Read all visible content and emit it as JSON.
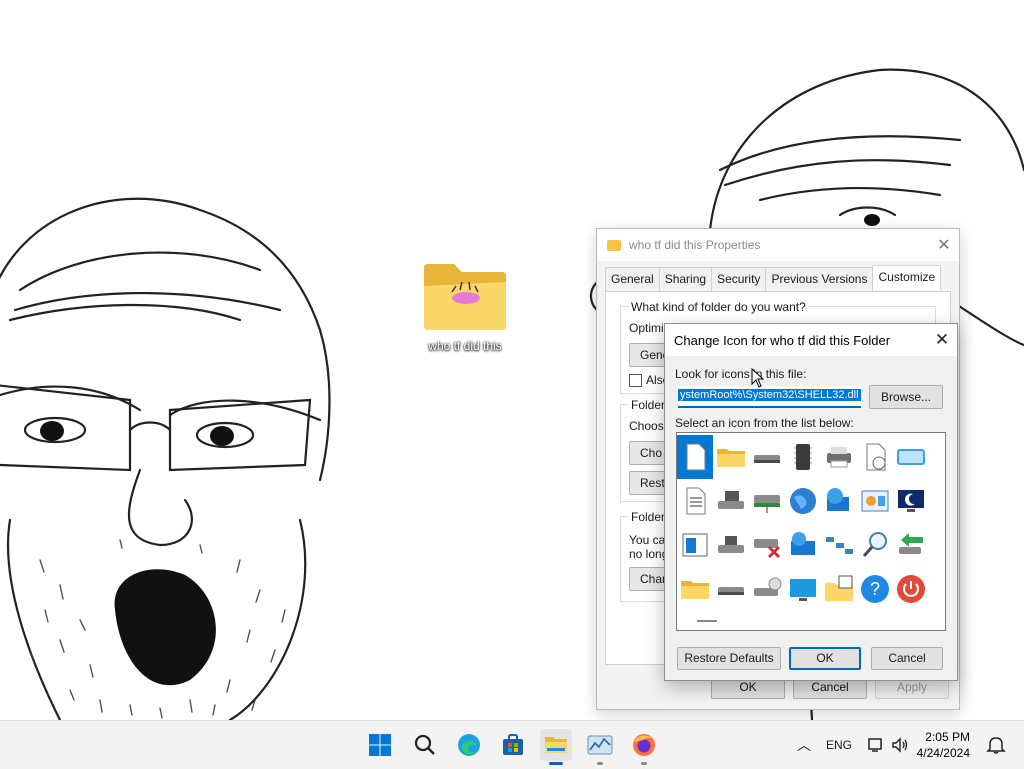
{
  "desktop": {
    "folder_label": "who tf did this"
  },
  "properties": {
    "title": "who tf did this Properties",
    "tabs": [
      "General",
      "Sharing",
      "Security",
      "Previous Versions",
      "Customize"
    ],
    "active_tab": "Customize",
    "q_kind": "What kind of folder do you want?",
    "optimize_label": "Optimize this folder for:",
    "optimize_value": "General",
    "also_apply": "Also",
    "folder_pictures_label": "Folder p",
    "choose_label": "Choose",
    "choose_btn": "Cho",
    "restore_btn": "Resto",
    "folder_icons_label": "Folder ic",
    "icons_text_1": "You ca",
    "icons_text_2": "no longe",
    "change_btn": "Char",
    "ok": "OK",
    "cancel": "Cancel",
    "apply": "Apply"
  },
  "change_icon": {
    "title": "Change Icon for who tf did this Folder",
    "look_label": "Look for icons in this file:",
    "path_value": "ystemRoot%\\System32\\SHELL32.dll",
    "browse": "Browse...",
    "select_label": "Select an icon from the list below:",
    "icons": [
      "blank-document-icon",
      "folder-icon",
      "drive-icon",
      "memory-chip-icon",
      "printer-icon",
      "clock-document-icon",
      "monitor-frame-icon",
      "text-document-icon",
      "floppy-drive-icon",
      "network-drive-icon",
      "globe-icon",
      "network-globe-icon",
      "control-panel-icon",
      "sleep-moon-icon",
      "window-icon",
      "disk-drive-icon",
      "drive-error-icon",
      "globe-monitor-icon",
      "network-icon",
      "magnifier-icon",
      "arrow-icon",
      "folder-icon",
      "drive-icon",
      "cd-drive-icon",
      "desktop-monitor-icon",
      "grid-folder-icon",
      "help-question-icon",
      "power-icon"
    ],
    "restore_defaults": "Restore Defaults",
    "ok": "OK",
    "cancel": "Cancel"
  },
  "taskbar": {
    "apps": [
      "start-icon",
      "search-icon",
      "edge-icon",
      "store-icon",
      "file-explorer-icon",
      "task-manager-icon",
      "firefox-icon"
    ],
    "language": "ENG",
    "time": "2:05 PM",
    "date": "4/24/2024"
  }
}
